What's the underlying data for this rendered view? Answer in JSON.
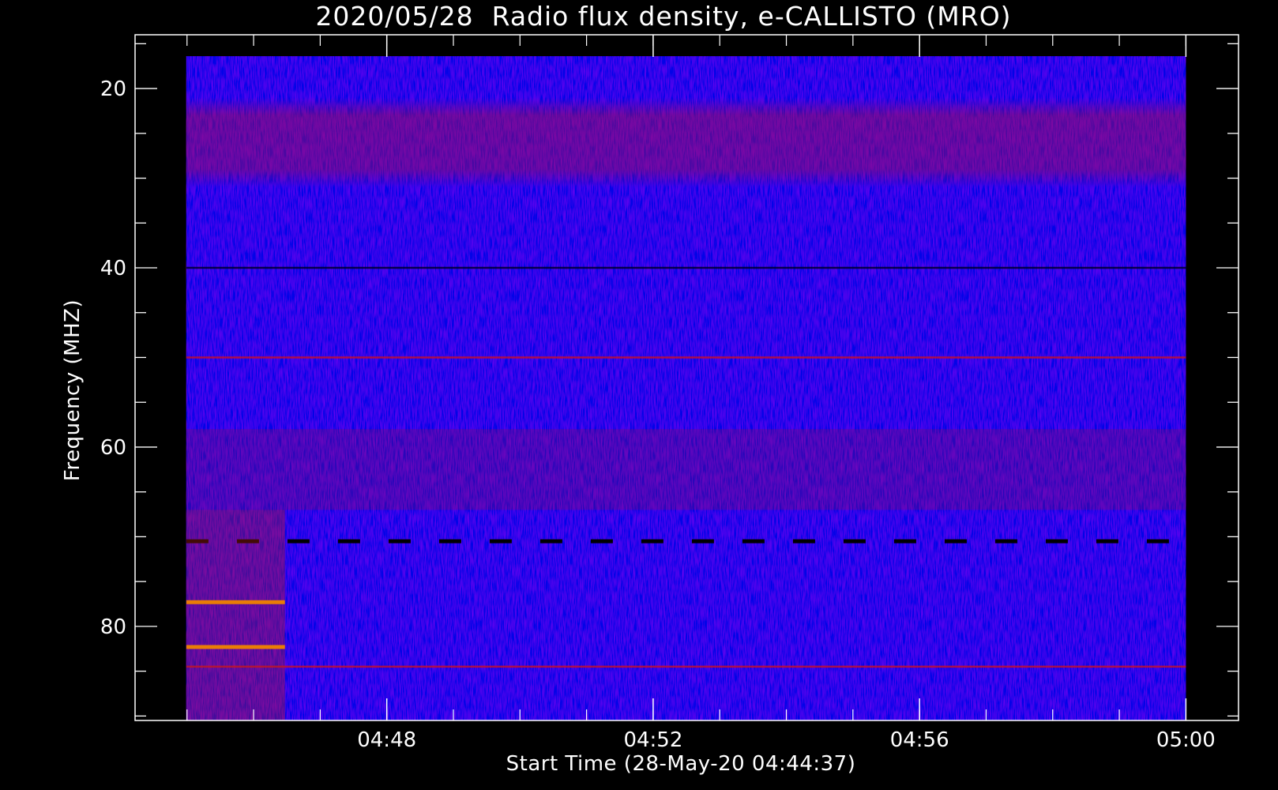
{
  "chart_data": {
    "type": "heatmap",
    "title": "2020/05/28  Radio flux density, e-CALLISTO (MRO)",
    "xlabel": "Start Time (28-May-20 04:44:37)",
    "ylabel": "Frequency (MHZ)",
    "x_ticks": [
      "04:48",
      "04:52",
      "04:56",
      "05:00"
    ],
    "x_tick_minutes": [
      3.38,
      7.38,
      11.38,
      15.38
    ],
    "xlim_minutes": [
      -0.4,
      16.17
    ],
    "data_extent_minutes": [
      0.37,
      15.38
    ],
    "y_ticks": [
      20,
      40,
      60,
      80
    ],
    "ylim": [
      14,
      90.5
    ],
    "y_inverted": true,
    "data_extent_mhz": [
      16.4,
      90.5
    ],
    "grid": false,
    "colormap": [
      "#000000",
      "#0000ff",
      "#ff0000",
      "#ffff00"
    ],
    "background_color": "#0808f0",
    "features": [
      {
        "kind": "emission band",
        "freq_range": [
          21,
          31
        ],
        "intensity": "moderate"
      },
      {
        "kind": "interference line",
        "freq": 40,
        "intensity": "low"
      },
      {
        "kind": "interference line",
        "freq": 50,
        "intensity": "moderate"
      },
      {
        "kind": "drifting emission",
        "freq_range": [
          58,
          67
        ],
        "intensity": "moderate"
      },
      {
        "kind": "dashed dropout line",
        "freq": 70.5,
        "intensity": "low"
      },
      {
        "kind": "strong emission",
        "freq": 77.3,
        "time_range_minutes": [
          0.37,
          1.85
        ],
        "intensity": "high"
      },
      {
        "kind": "strong emission",
        "freq": 82.3,
        "time_range_minutes": [
          0.37,
          1.85
        ],
        "intensity": "high"
      },
      {
        "kind": "emission line",
        "freq": 84.5,
        "intensity": "moderate"
      }
    ]
  }
}
